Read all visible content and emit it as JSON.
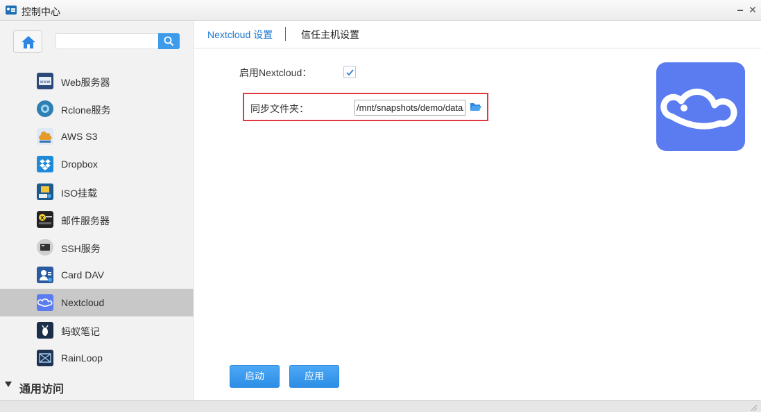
{
  "window": {
    "title": "控制中心"
  },
  "search": {
    "placeholder": "",
    "value": ""
  },
  "sidebar": {
    "items": [
      {
        "label": "Web服务器",
        "icon": "web-server-icon",
        "color": "#2b4a7a"
      },
      {
        "label": "Rclone服务",
        "icon": "rclone-icon",
        "color": "#2f7fb2"
      },
      {
        "label": "AWS S3",
        "icon": "aws-s3-icon",
        "color": "#e69a2a"
      },
      {
        "label": "Dropbox",
        "icon": "dropbox-icon",
        "color": "#1f8ad9"
      },
      {
        "label": "ISO挂载",
        "icon": "iso-mount-icon",
        "color": "#1f5a8f"
      },
      {
        "label": "邮件服务器",
        "icon": "mail-server-icon",
        "color": "#222222"
      },
      {
        "label": "SSH服务",
        "icon": "ssh-icon",
        "color": "#333333"
      },
      {
        "label": "Card DAV",
        "icon": "carddav-icon",
        "color": "#2a5aa0"
      },
      {
        "label": "Nextcloud",
        "icon": "nextcloud-icon",
        "color": "#5b7cf0",
        "active": true
      },
      {
        "label": "蚂蚁笔记",
        "icon": "leanote-icon",
        "color": "#1a2e4a"
      },
      {
        "label": "RainLoop",
        "icon": "rainloop-icon",
        "color": "#1e3350"
      }
    ],
    "section": {
      "label": "通用访问"
    }
  },
  "tabs": [
    {
      "label": "Nextcloud 设置",
      "active": true
    },
    {
      "label": "信任主机设置",
      "active": false
    }
  ],
  "form": {
    "enable_label": "启用Nextcloud：",
    "enable_checked": true,
    "sync_label": "同步文件夹：",
    "sync_value": "/mnt/snapshots/demo/data/"
  },
  "buttons": {
    "start": "启动",
    "apply": "应用"
  },
  "colors": {
    "accent": "#1e78d0",
    "button": "#3d9be9",
    "highlight": "#e0383e",
    "logo": "#5b7cf0"
  }
}
